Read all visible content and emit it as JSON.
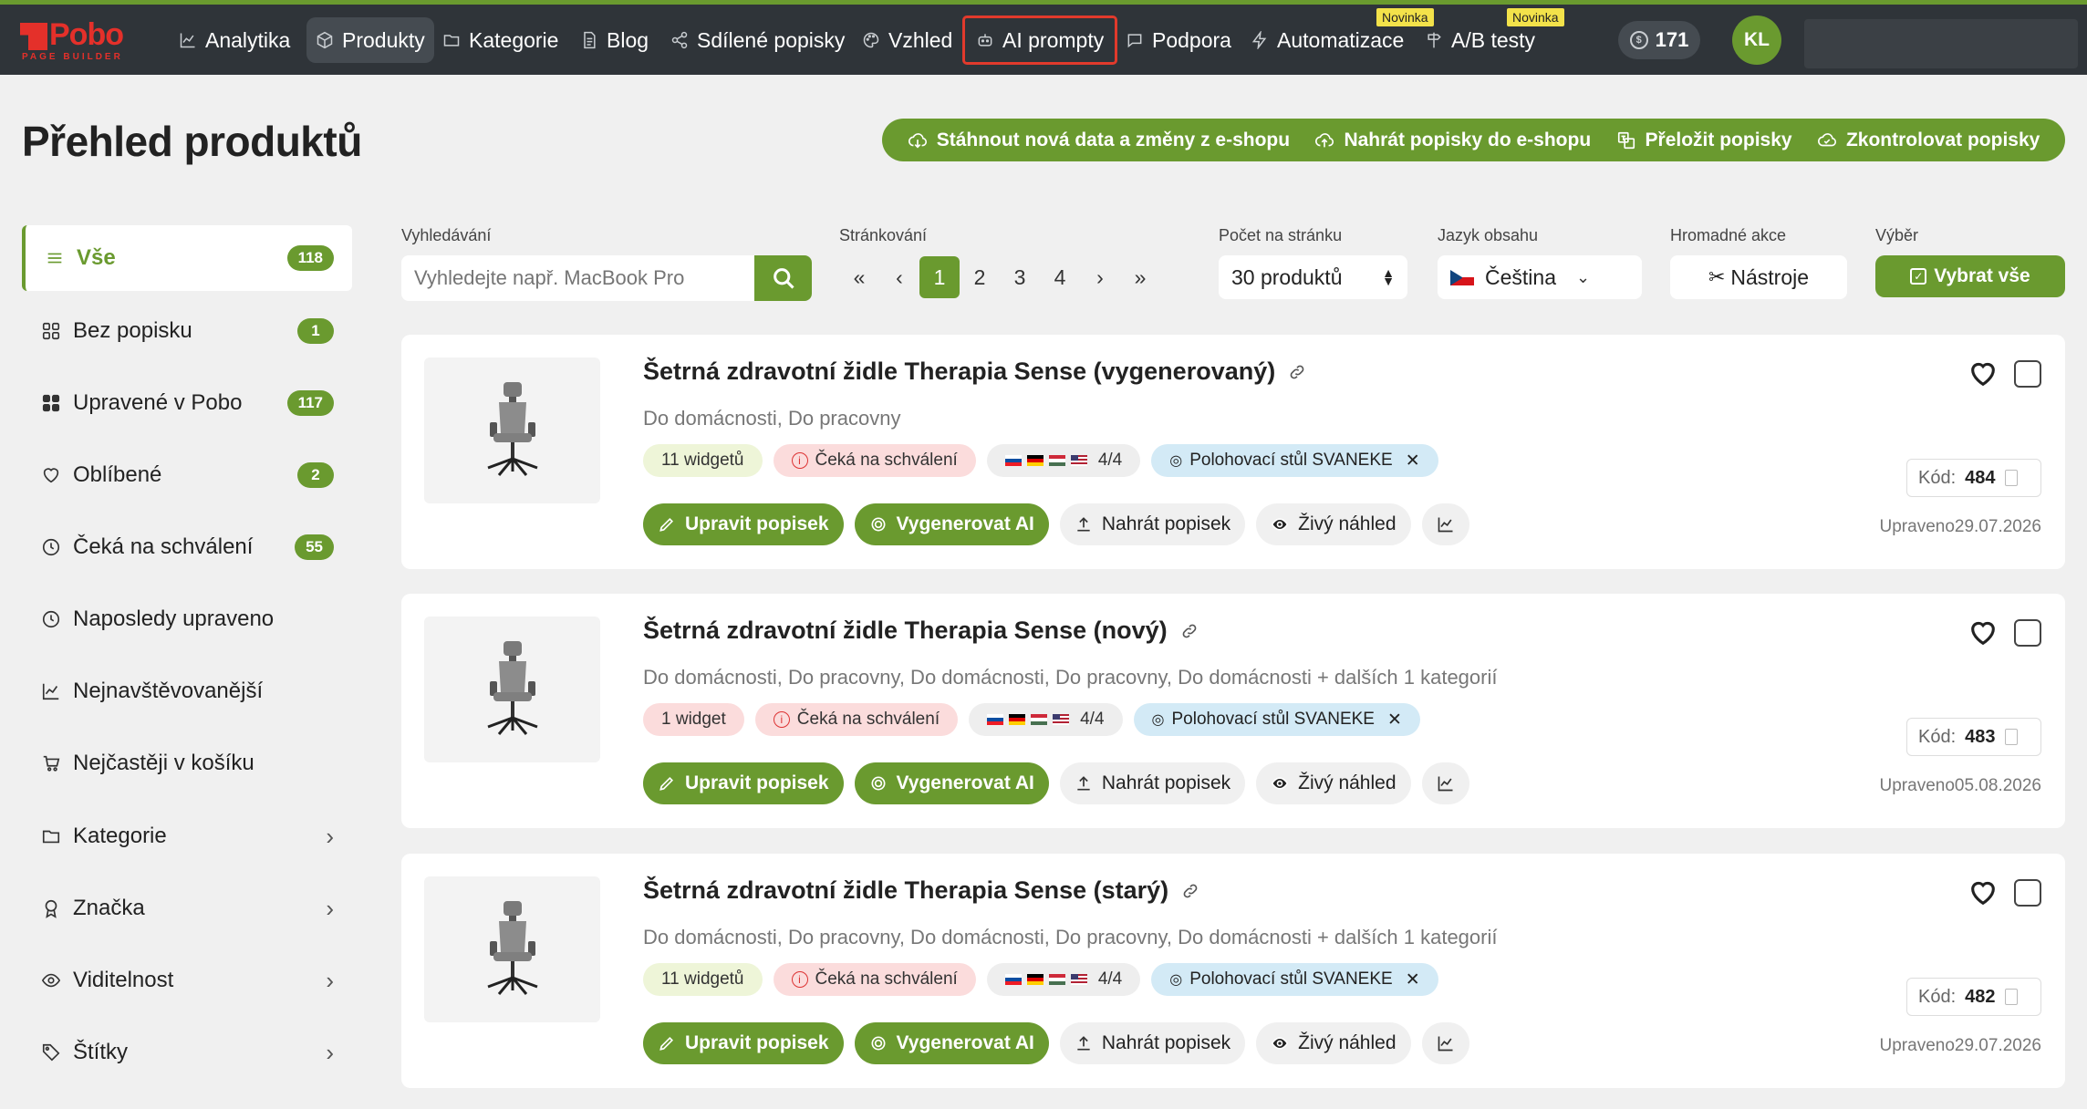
{
  "brand": {
    "name": "Pobo",
    "tagline": "PAGE BUILDER"
  },
  "nav": {
    "items": [
      {
        "label": "Analytika",
        "icon": "chart-line-icon"
      },
      {
        "label": "Produkty",
        "icon": "box-icon"
      },
      {
        "label": "Kategorie",
        "icon": "folder-icon"
      },
      {
        "label": "Blog",
        "icon": "document-icon"
      },
      {
        "label": "Sdílené popisky",
        "icon": "share-icon"
      },
      {
        "label": "Vzhled",
        "icon": "palette-icon"
      },
      {
        "label": "AI prompty",
        "icon": "robot-icon"
      },
      {
        "label": "Podpora",
        "icon": "chat-icon"
      },
      {
        "label": "Automatizace",
        "icon": "bolt-icon",
        "badge": "Novinka"
      },
      {
        "label": "A/B testy",
        "icon": "signpost-icon",
        "badge": "Novinka"
      }
    ],
    "credits": "171",
    "avatar": "KL"
  },
  "page": {
    "title": "Přehled produktů"
  },
  "actions": [
    {
      "label": "Stáhnout nová data a změny z e-shopu"
    },
    {
      "label": "Nahrát popisky do e-shopu"
    },
    {
      "label": "Přeložit popisky"
    },
    {
      "label": "Zkontrolovat popisky"
    }
  ],
  "sidebar": {
    "items": [
      {
        "label": "Vše",
        "count": "118"
      },
      {
        "label": "Bez popisku",
        "count": "1"
      },
      {
        "label": "Upravené v Pobo",
        "count": "117"
      },
      {
        "label": "Oblíbené",
        "count": "2"
      },
      {
        "label": "Čeká na schválení",
        "count": "55"
      },
      {
        "label": "Naposledy upraveno"
      },
      {
        "label": "Nejnavštěvovanější"
      },
      {
        "label": "Nejčastěji v košíku"
      },
      {
        "label": "Kategorie"
      },
      {
        "label": "Značka"
      },
      {
        "label": "Viditelnost"
      },
      {
        "label": "Štítky"
      }
    ]
  },
  "filters": {
    "search_label": "Vyhledávání",
    "search_placeholder": "Vyhledejte např. MacBook Pro",
    "pagination_label": "Stránkování",
    "pages": [
      "«",
      "‹",
      "1",
      "2",
      "3",
      "4",
      "›",
      "»"
    ],
    "per_page_label": "Počet na stránku",
    "per_page_value": "30 produktů",
    "language_label": "Jazyk obsahu",
    "language_value": "Čeština",
    "bulk_label": "Hromadné akce",
    "bulk_value": "Nástroje",
    "select_label": "Výběr",
    "select_value": "Vybrat vše"
  },
  "buttons": {
    "edit": "Upravit popisek",
    "generate": "Vygenerovat AI",
    "upload": "Nahrát popisek",
    "preview": "Živý náhled"
  },
  "products": [
    {
      "title": "Šetrná zdravotní židle Therapia Sense (vygenerovaný)",
      "categories": "Do domácnosti, Do pracovny",
      "widgets": "11 widgetů",
      "widgets_tone": "green",
      "status": "Čeká na schválení",
      "languages": "4/4",
      "linked": "Polohovací stůl SVANEKE",
      "code_label": "Kód:",
      "code": "484",
      "updated": "Upraveno29.07.2026"
    },
    {
      "title": "Šetrná zdravotní židle Therapia Sense (nový)",
      "categories": "Do domácnosti, Do pracovny, Do domácnosti, Do pracovny, Do domácnosti + dalších 1 kategorií",
      "widgets": "1 widget",
      "widgets_tone": "red",
      "status": "Čeká na schválení",
      "languages": "4/4",
      "linked": "Polohovací stůl SVANEKE",
      "code_label": "Kód:",
      "code": "483",
      "updated": "Upraveno05.08.2026"
    },
    {
      "title": "Šetrná zdravotní židle Therapia Sense (starý)",
      "categories": "Do domácnosti, Do pracovny, Do domácnosti, Do pracovny, Do domácnosti + dalších 1 kategorií",
      "widgets": "11 widgetů",
      "widgets_tone": "green",
      "status": "Čeká na schválení",
      "languages": "4/4",
      "linked": "Polohovací stůl SVANEKE",
      "code_label": "Kód:",
      "code": "482",
      "updated": "Upraveno29.07.2026"
    }
  ],
  "colors": {
    "accent": "#6a9a2f",
    "navbar": "#2f3439",
    "highlight": "#e23a2c",
    "brand": "#e4302a"
  }
}
